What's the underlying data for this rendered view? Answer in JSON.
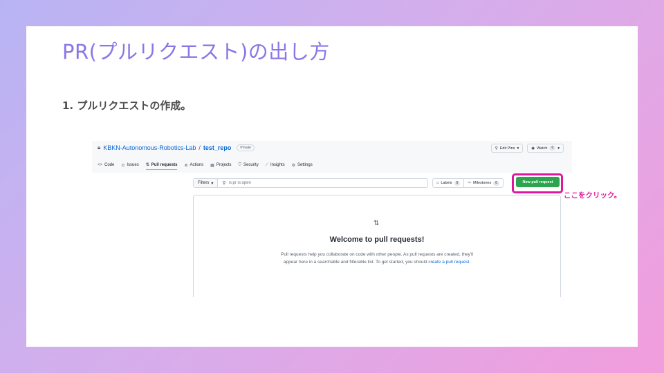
{
  "slide": {
    "title": "PR(プルリクエスト)の出し方",
    "step_heading": "1. プルリクエストの作成。",
    "annotation": "ここをクリック。"
  },
  "repo": {
    "owner": "KBKN-Autonomous-Robotics-Lab",
    "separator": "/",
    "name": "test_repo",
    "visibility": "Private",
    "edit_pins_label": "Edit Pins",
    "watch_label": "Watch",
    "watch_count": "0"
  },
  "tabs": [
    {
      "label": "Code",
      "icon": "code-icon"
    },
    {
      "label": "Issues",
      "icon": "issues-icon"
    },
    {
      "label": "Pull requests",
      "icon": "pull-request-icon"
    },
    {
      "label": "Actions",
      "icon": "actions-icon"
    },
    {
      "label": "Projects",
      "icon": "projects-icon"
    },
    {
      "label": "Security",
      "icon": "shield-icon"
    },
    {
      "label": "Insights",
      "icon": "graph-icon"
    },
    {
      "label": "Settings",
      "icon": "gear-icon"
    }
  ],
  "toolbar": {
    "filters_label": "Filters",
    "search_placeholder": "is:pr is:open",
    "labels_label": "Labels",
    "labels_count": "0",
    "milestones_label": "Milestones",
    "milestones_count": "0",
    "new_pr_label": "New pull request"
  },
  "empty_state": {
    "heading": "Welcome to pull requests!",
    "desc_line1": "Pull requests help you collaborate on code with other people. As pull requests are created, they'll",
    "desc_line2_prefix": "appear here in a searchable and filterable list. To get started, you should",
    "desc_link": "create a pull request",
    "desc_suffix": "."
  },
  "colors": {
    "title": "#8a76e6",
    "annotation": "#e0179b",
    "primary_button": "#2da44e",
    "link": "#0969da"
  }
}
